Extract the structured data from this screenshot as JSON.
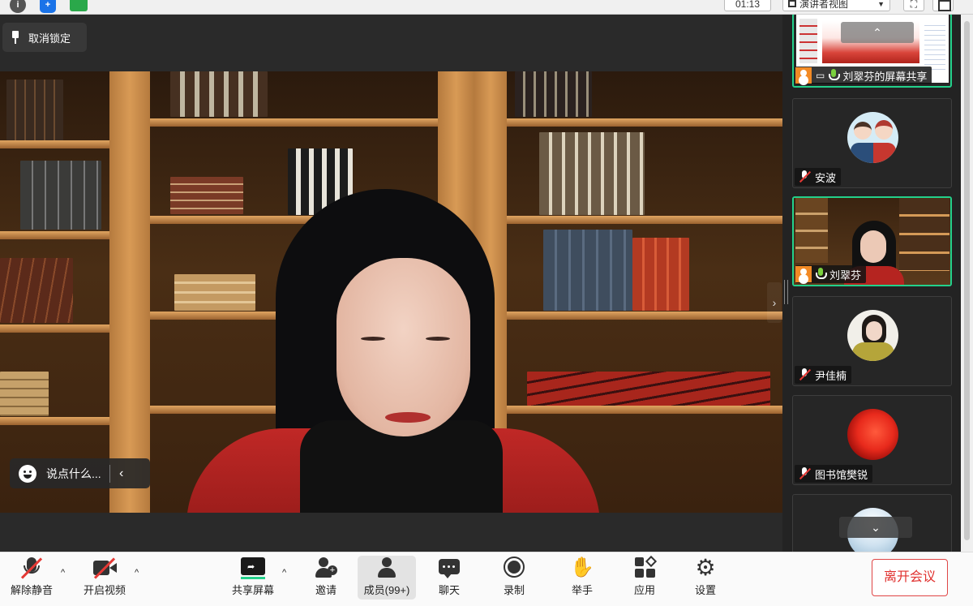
{
  "topbar": {
    "timer": "01:13",
    "view_mode": "演讲者视图"
  },
  "main": {
    "unpin_label": "取消锁定",
    "chat_placeholder": "说点什么...",
    "side_arrow": "›"
  },
  "participants": [
    {
      "name": "刘翠芬的屏幕共享",
      "type": "screen-share"
    },
    {
      "name": "安波",
      "muted": true
    },
    {
      "name": "刘翠芬",
      "muted": false,
      "host": true
    },
    {
      "name": "尹佳楠",
      "muted": true
    },
    {
      "name": "图书馆樊锐",
      "muted": true
    }
  ],
  "toolbar": {
    "unmute_label": "解除静音",
    "video_label": "开启视频",
    "share_label": "共享屏幕",
    "invite_label": "邀请",
    "members_label": "成员(99+)",
    "chat_label": "聊天",
    "record_label": "录制",
    "raise_hand_label": "举手",
    "apps_label": "应用",
    "settings_label": "设置",
    "leave_label": "离开会议"
  },
  "colors": {
    "accent_green": "#23d18b",
    "leave_red": "#e0302e",
    "host_orange": "#f28a25"
  }
}
